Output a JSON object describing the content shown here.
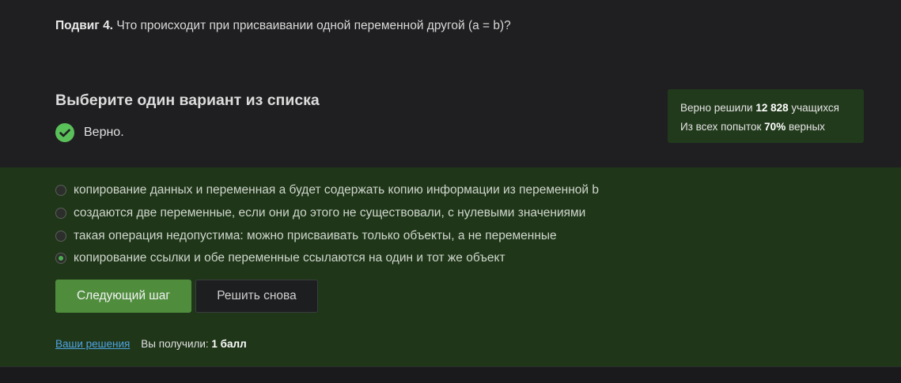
{
  "question": {
    "label": "Подвиг 4.",
    "text": "Что происходит при присваивании одной переменной другой (a = b)?"
  },
  "choose_title": "Выберите один вариант из списка",
  "verdict": "Верно.",
  "stats": {
    "line1_prefix": "Верно решили",
    "line1_count": "12 828",
    "line1_suffix": "учащихся",
    "line2_prefix": "Из всех попыток",
    "line2_percent": "70%",
    "line2_suffix": "верных"
  },
  "options": [
    {
      "label": "копирование данных и переменная a будет содержать копию информации из переменной b",
      "checked": false
    },
    {
      "label": "создаются две переменные, если они до этого не существовали, с нулевыми значениями",
      "checked": false
    },
    {
      "label": "такая операция недопустима: можно присваивать только объекты, а не переменные",
      "checked": false
    },
    {
      "label": "копирование ссылки и обе переменные ссылаются на один и тот же объект",
      "checked": true
    }
  ],
  "buttons": {
    "next": "Следующий шаг",
    "retry": "Решить снова"
  },
  "footer": {
    "solutions_link": "Ваши решения",
    "score_prefix": "Вы получили:",
    "score_value": "1 балл"
  },
  "colors": {
    "accent_green": "#4f8d3d",
    "check_green": "#5ac05a",
    "link_blue": "#4fa3e0"
  }
}
